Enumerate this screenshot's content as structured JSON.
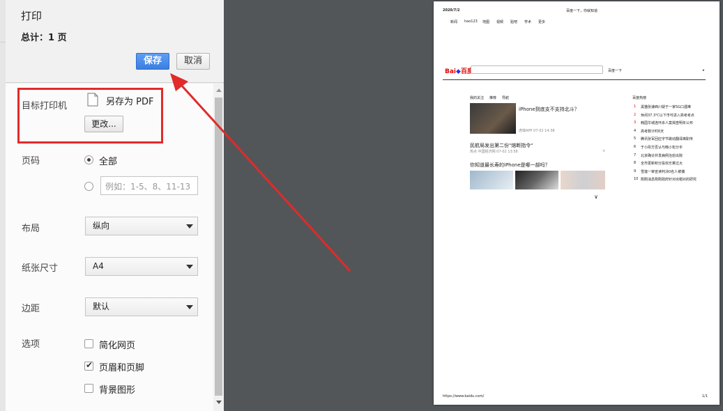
{
  "header": {
    "title": "打印",
    "total": "总计：1 页",
    "save_label": "保存",
    "cancel_label": "取消"
  },
  "destination": {
    "label": "目标打印机",
    "printer_name": "另存为 PDF",
    "change_label": "更改..."
  },
  "pages": {
    "label": "页码",
    "all_label": "全部",
    "range_placeholder": "例如：1-5、8、11-13"
  },
  "layout": {
    "label": "布局",
    "value": "纵向"
  },
  "paper": {
    "label": "纸张尺寸",
    "value": "A4"
  },
  "margins": {
    "label": "边距",
    "value": "默认"
  },
  "options": {
    "label": "选项",
    "items": [
      {
        "label": "简化网页",
        "checked": false
      },
      {
        "label": "页眉和页脚",
        "checked": true
      },
      {
        "label": "背景图形",
        "checked": false
      }
    ]
  },
  "preview": {
    "date": "2020/7/2",
    "page_title": "百度一下，你就知道",
    "nav": [
      "新闻",
      "hao123",
      "地图",
      "视频",
      "贴吧",
      "学术",
      "更多"
    ],
    "search_button": "百度一下",
    "tabs": [
      "我的关注",
      "推荐",
      "导航"
    ],
    "news1_title": "iPhone到底支不支持北斗？",
    "news1_meta": "虎嗅APP  07-02 14:38",
    "news2_title": "民航局发出第二份\"熔断指令\"",
    "news2_meta": "热点  中国经济网  07-02 13:58",
    "news3_title": "你知道最长寿的iPhone是哪一部吗？",
    "hot_title": "百度热榜",
    "hot_items": [
      "黑猫张谦西川疑于一家5G口遇难",
      "休闲37.3℃以下市可进入高考考点",
      "韩国华城连环杀人案揭查明年公布",
      "高考数计时6天",
      "腾讯张军回应字节跳动翻译离职传",
      "于小彤方否认与韩小松分手",
      "北京确诊并发病例治愈出院",
      "全市更新积分投欢乐乘过大",
      "雪莲一审宣读判决0名人被捕",
      "刚刚消息刚刚政府针对出帽对的研究"
    ],
    "footer_url": "https://www.baidu.com/",
    "footer_page": "1/1",
    "colors": {
      "baidu_red": "#e10602",
      "baidu_blue": "#2932e1"
    }
  },
  "annotation": {
    "color": "#e12a2a"
  }
}
